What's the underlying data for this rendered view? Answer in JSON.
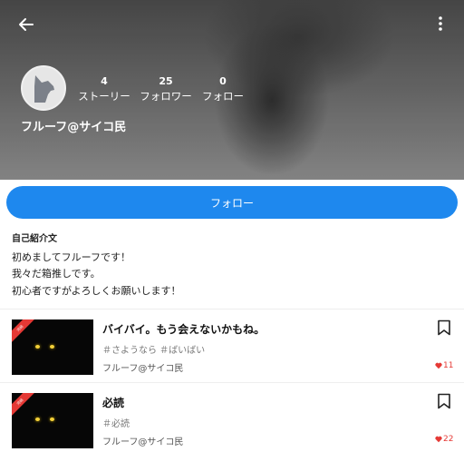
{
  "header": {
    "back_icon": "back-arrow-icon",
    "menu_icon": "kebab-menu-icon"
  },
  "profile": {
    "name": "フルーフ@サイコ民",
    "avatar_icon": "cat-silhouette-icon",
    "stats": [
      {
        "value": "4",
        "label": "ストーリー"
      },
      {
        "value": "25",
        "label": "フォロワー"
      },
      {
        "value": "0",
        "label": "フォロー"
      }
    ]
  },
  "follow_button": {
    "label": "フォロー",
    "color": "#1e88ee"
  },
  "bio": {
    "heading": "自己紹介文",
    "lines": [
      "初めましてフルーフです！",
      "我々だ箱推しです。",
      "初心者ですがよろしくお願いします！"
    ]
  },
  "stories": [
    {
      "title": "バイバイ。もう会えないかもね。",
      "tags": "＃さようなら ＃ばいばい",
      "author": "フルーフ@サイコ民",
      "likes": "11",
      "badge": "完結"
    },
    {
      "title": "必読",
      "tags": "＃必読",
      "author": "フルーフ@サイコ民",
      "likes": "22",
      "badge": "完結"
    }
  ],
  "colors": {
    "accent": "#1e88ee",
    "like": "#e53935"
  }
}
